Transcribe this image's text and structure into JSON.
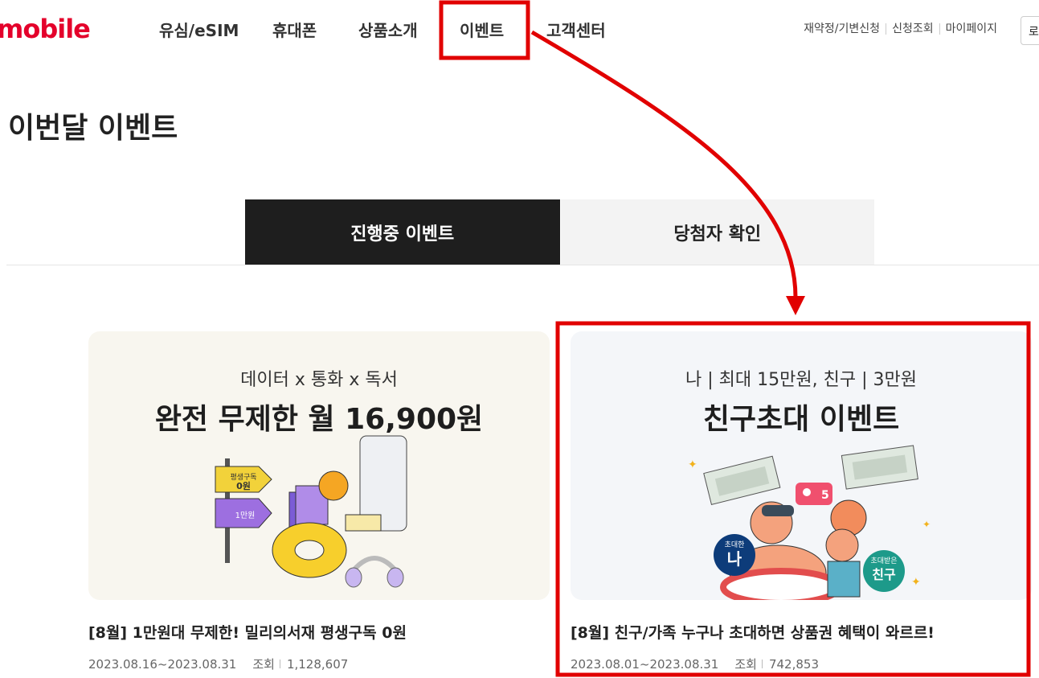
{
  "header": {
    "logo": "mobile",
    "nav": [
      "유심/eSIM",
      "휴대폰",
      "상품소개",
      "이벤트",
      "고객센터"
    ],
    "active_nav": "이벤트",
    "util_links": [
      "재약정/기변신청",
      "신청조회",
      "마이페이지"
    ],
    "login_partial": "로"
  },
  "page": {
    "title": "이번달 이벤트",
    "tabs": [
      "진행중 이벤트",
      "당첨자 확인"
    ],
    "active_tab": "진행중 이벤트"
  },
  "events": [
    {
      "banner_sub": "데이터 x 통화 x 독서",
      "banner_title": "완전 무제한 월 16,900원",
      "banner_bg": "#f8f6ef",
      "sign_text_1": "평생구독",
      "sign_text_2": "0원",
      "sign_text_3": "1만원",
      "caption": "[8월] 1만원대 무제한! 밀리의서재 평생구독 0원",
      "period": "2023.08.16~2023.08.31",
      "views_label": "조회",
      "views": "1,128,607"
    },
    {
      "banner_sub": "나 | 최대 15만원, 친구 | 3만원",
      "banner_title": "친구초대 이벤트",
      "banner_bg": "#f4f6f9",
      "badge_me_top": "초대한",
      "badge_me": "나",
      "badge_friend_top": "초대받은",
      "badge_friend": "친구",
      "chat_count": "5",
      "caption": "[8월] 친구/가족 누구나 초대하면 상품권 혜택이 와르르!",
      "period": "2023.08.01~2023.08.31",
      "views_label": "조회",
      "views": "742,853"
    }
  ],
  "colors": {
    "brand": "#e4002b",
    "annotation": "#e10000",
    "tab_active": "#1e1e1e"
  }
}
